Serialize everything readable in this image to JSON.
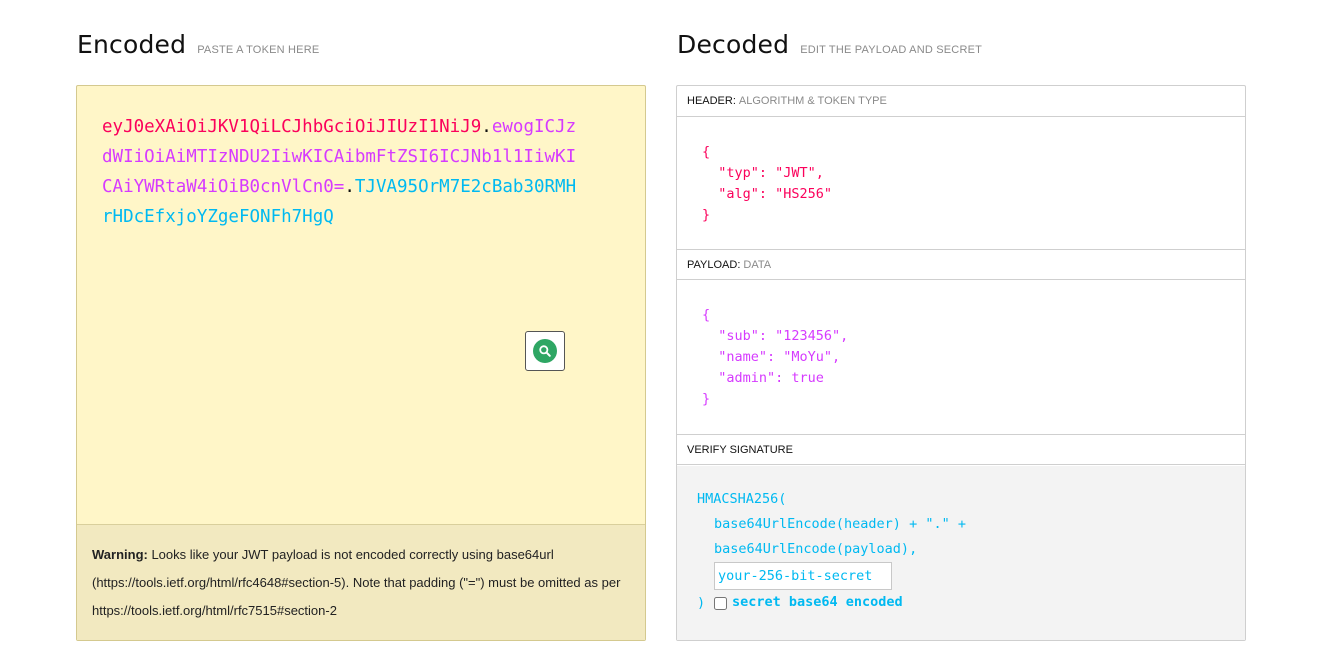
{
  "encoded": {
    "title": "Encoded",
    "subtitle": "PASTE A TOKEN HERE",
    "token_header": "eyJ0eXAiOiJKV1QiLCJhbGciOiJIUzI1NiJ9",
    "token_payload": "ewogICJzdWIiOiAiMTIzNDU2IiwKICAibmFtZSI6ICJNb1l1IiwKICAiYWRtaW4iOiB0cnVlCn0=",
    "token_signature": "TJVA95OrM7E2cBab30RMHrHDcEfxjoYZgeFONFh7HgQ",
    "dot": ".",
    "warning_label": "Warning:",
    "warning_text": " Looks like your JWT payload is not encoded correctly using base64url (https://tools.ietf.org/html/rfc4648#section-5). Note that padding (\"=\") must be omitted as per https://tools.ietf.org/html/rfc7515#section-2",
    "zoom_icon": "search-icon"
  },
  "decoded": {
    "title": "Decoded",
    "subtitle": "EDIT THE PAYLOAD AND SECRET",
    "header_label": "HEADER:",
    "header_sub": "ALGORITHM & TOKEN TYPE",
    "header_json": "{\n  \"typ\": \"JWT\",\n  \"alg\": \"HS256\"\n}",
    "payload_label": "PAYLOAD:",
    "payload_sub": "DATA",
    "payload_json": "{\n  \"sub\": \"123456\",\n  \"name\": \"MoYu\",\n  \"admin\": true\n}",
    "verify_label": "VERIFY SIGNATURE",
    "sig_line1": "HMACSHA256(",
    "sig_line2": "base64UrlEncode(header) + \".\" +",
    "sig_line3": "base64UrlEncode(payload),",
    "secret_placeholder": "your-256-bit-secret",
    "sig_close": ")",
    "b64_label": "secret base64 encoded"
  },
  "colors": {
    "header": "#fb015b",
    "payload": "#d63aff",
    "signature": "#00b9f1",
    "encoded_bg": "#fff6c8",
    "warning_bg": "#f2e9c0",
    "zoom_green": "#2ea663"
  }
}
